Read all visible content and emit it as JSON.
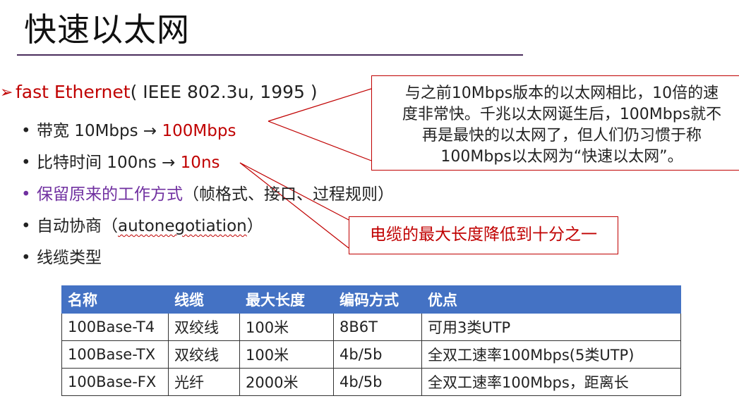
{
  "slide": {
    "title": "快速以太网",
    "line1_prefix": "fast Ethernet",
    "line1_suffix": "( IEEE 802.3u, 1995 )",
    "bullets": [
      {
        "dot": "•",
        "text": "带宽 10Mbps → ",
        "highlight": "100Mbps"
      },
      {
        "dot": "•",
        "text": "比特时间 100ns → ",
        "highlight": "10ns"
      },
      {
        "dot": "•",
        "text": "保留原来的工作方式",
        "suffix": "（帧格式、接口、过程规则）"
      },
      {
        "dot": "•",
        "text": "自动协商（",
        "wavy": "autonegotiation",
        "suffix": "）"
      },
      {
        "dot": "•",
        "text": "线缆类型"
      }
    ],
    "callout1_lines": [
      "与之前10Mbps版本的以太网相比，10倍的速",
      "度非常快。千兆以太网诞生后，100Mbps就不",
      "再是最快的以太网了，但人们仍习惯于称",
      "100Mbps以太网为“快速以太网”。"
    ],
    "callout2": "电缆的最大长度降低到十分之一"
  },
  "table": {
    "headers": [
      "名称",
      "线缆",
      "最大长度",
      "编码方式",
      "优点"
    ],
    "rows": [
      [
        "100Base-T4",
        "双绞线",
        "100米",
        "8B6T",
        "可用3类UTP"
      ],
      [
        "100Base-TX",
        "双绞线",
        "100米",
        "4b/5b",
        "全双工速率100Mbps(5类UTP)"
      ],
      [
        "100Base-FX",
        "光纤",
        "2000米",
        "4b/5b",
        "全双工速率100Mbps，距离长"
      ]
    ]
  },
  "colors": {
    "accent_red": "#c00000",
    "purple": "#7030a0",
    "table_header": "#4472c4"
  }
}
